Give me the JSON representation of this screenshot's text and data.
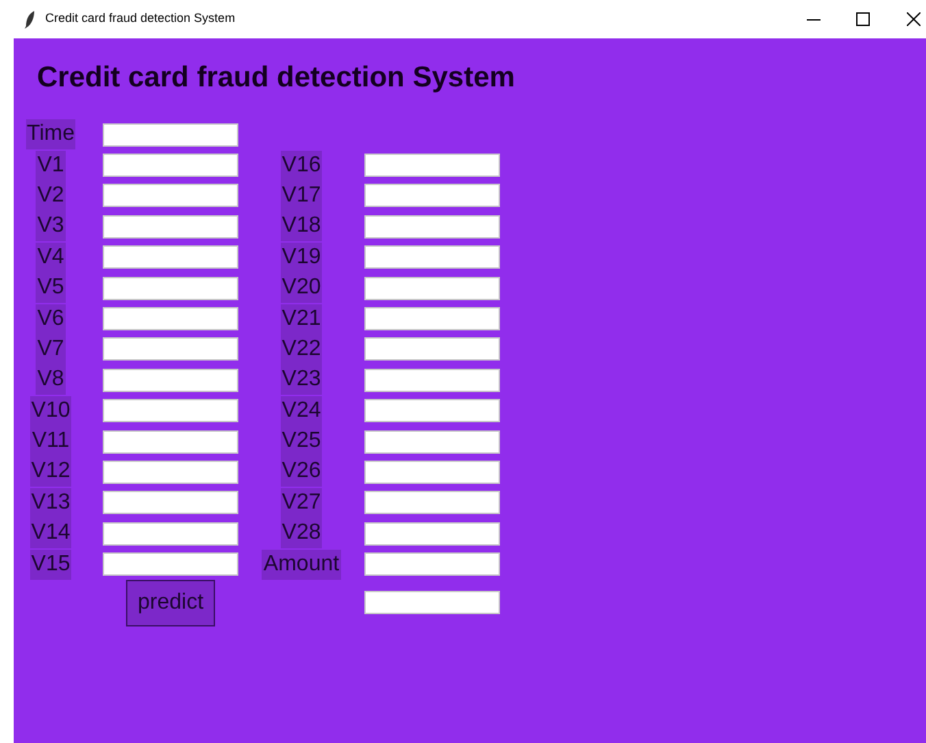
{
  "window": {
    "title": "Credit card fraud detection System"
  },
  "heading": "Credit card fraud detection System",
  "left_fields": [
    {
      "label": "Time"
    },
    {
      "label": "V1"
    },
    {
      "label": "V2"
    },
    {
      "label": "V3"
    },
    {
      "label": "V4"
    },
    {
      "label": "V5"
    },
    {
      "label": "V6"
    },
    {
      "label": "V7"
    },
    {
      "label": "V8"
    },
    {
      "label": "V10"
    },
    {
      "label": "V11"
    },
    {
      "label": "V12"
    },
    {
      "label": "V13"
    },
    {
      "label": "V14"
    },
    {
      "label": "V15"
    }
  ],
  "right_fields": [
    {
      "label": "V16"
    },
    {
      "label": "V17"
    },
    {
      "label": "V18"
    },
    {
      "label": "V19"
    },
    {
      "label": "V20"
    },
    {
      "label": "V21"
    },
    {
      "label": "V22"
    },
    {
      "label": "V23"
    },
    {
      "label": "V24"
    },
    {
      "label": "V25"
    },
    {
      "label": "V26"
    },
    {
      "label": "V27"
    },
    {
      "label": "V28"
    },
    {
      "label": "Amount"
    }
  ],
  "predict_button": "predict",
  "result_field": {
    "kind": "entry"
  }
}
